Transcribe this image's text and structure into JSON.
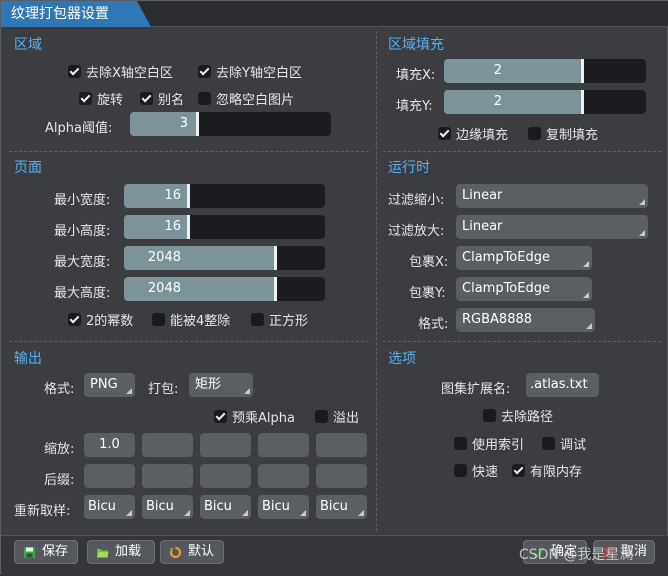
{
  "window": {
    "title": "纹理打包器设置"
  },
  "region": {
    "title": "区域",
    "strip_x": "去除X轴空白区",
    "strip_y": "去除Y轴空白区",
    "rotation": "旋转",
    "alias": "别名",
    "ignore_blank": "忽略空白图片",
    "alpha_label": "Alpha阈值:",
    "alpha_value": "3",
    "alpha_fill": 0.02
  },
  "region_fill": {
    "title": "区域填充",
    "fill_x_label": "填充X:",
    "fill_x_value": "2",
    "fill_x_fill": 0.55,
    "fill_y_label": "填充Y:",
    "fill_y_value": "2",
    "fill_y_fill": 0.55,
    "edge_fill": "边缘填充",
    "copy_fill": "复制填充"
  },
  "page": {
    "title": "页面",
    "min_width_label": "最小宽度:",
    "min_width_value": "16",
    "min_width_fill": 0.02,
    "min_height_label": "最小高度:",
    "min_height_value": "16",
    "min_height_fill": 0.02,
    "max_width_label": "最大宽度:",
    "max_width_value": "2048",
    "max_width_fill": 0.65,
    "max_height_label": "最大高度:",
    "max_height_value": "2048",
    "max_height_fill": 0.65,
    "pow2": "2的幂数",
    "div4": "能被4整除",
    "square": "正方形"
  },
  "runtime": {
    "title": "运行时",
    "filter_min_label": "过滤缩小:",
    "filter_min_value": "Linear",
    "filter_mag_label": "过滤放大:",
    "filter_mag_value": "Linear",
    "wrap_x_label": "包裹X:",
    "wrap_x_value": "ClampToEdge",
    "wrap_y_label": "包裹Y:",
    "wrap_y_value": "ClampToEdge",
    "format_label": "格式:",
    "format_value": "RGBA8888"
  },
  "output": {
    "title": "输出",
    "format_label": "格式:",
    "format_value": "PNG",
    "packing_label": "打包:",
    "packing_value": "矩形",
    "premultiply": "预乘Alpha",
    "bleed": "溢出",
    "scale_label": "缩放:",
    "scale_values": [
      "1.0",
      "",
      "",
      "",
      ""
    ],
    "suffix_label": "后缀:",
    "resample_label": "重新取样:",
    "resample_values": [
      "Bicu",
      "Bicu",
      "Bicu",
      "Bicu",
      "Bicu"
    ]
  },
  "options": {
    "title": "选项",
    "atlas_ext_label": "图集扩展名:",
    "atlas_ext_value": ".atlas.txt",
    "strip_path": "去除路径",
    "use_indexes": "使用索引",
    "debug": "调试",
    "fast": "快速",
    "limit_memory": "有限内存"
  },
  "footer": {
    "save": "保存",
    "load": "加载",
    "default": "默认",
    "ok": "确定",
    "cancel": "取消",
    "watermark": "CSDN @我是星澜"
  }
}
